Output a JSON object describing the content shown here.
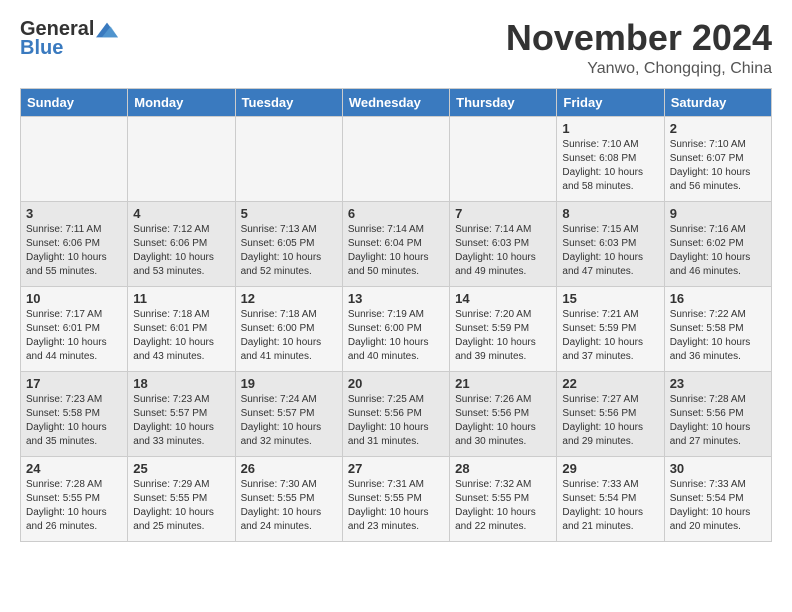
{
  "header": {
    "logo_general": "General",
    "logo_blue": "Blue",
    "month_title": "November 2024",
    "location": "Yanwo, Chongqing, China"
  },
  "days_of_week": [
    "Sunday",
    "Monday",
    "Tuesday",
    "Wednesday",
    "Thursday",
    "Friday",
    "Saturday"
  ],
  "weeks": [
    [
      {
        "day": "",
        "info": ""
      },
      {
        "day": "",
        "info": ""
      },
      {
        "day": "",
        "info": ""
      },
      {
        "day": "",
        "info": ""
      },
      {
        "day": "",
        "info": ""
      },
      {
        "day": "1",
        "info": "Sunrise: 7:10 AM\nSunset: 6:08 PM\nDaylight: 10 hours\nand 58 minutes."
      },
      {
        "day": "2",
        "info": "Sunrise: 7:10 AM\nSunset: 6:07 PM\nDaylight: 10 hours\nand 56 minutes."
      }
    ],
    [
      {
        "day": "3",
        "info": "Sunrise: 7:11 AM\nSunset: 6:06 PM\nDaylight: 10 hours\nand 55 minutes."
      },
      {
        "day": "4",
        "info": "Sunrise: 7:12 AM\nSunset: 6:06 PM\nDaylight: 10 hours\nand 53 minutes."
      },
      {
        "day": "5",
        "info": "Sunrise: 7:13 AM\nSunset: 6:05 PM\nDaylight: 10 hours\nand 52 minutes."
      },
      {
        "day": "6",
        "info": "Sunrise: 7:14 AM\nSunset: 6:04 PM\nDaylight: 10 hours\nand 50 minutes."
      },
      {
        "day": "7",
        "info": "Sunrise: 7:14 AM\nSunset: 6:03 PM\nDaylight: 10 hours\nand 49 minutes."
      },
      {
        "day": "8",
        "info": "Sunrise: 7:15 AM\nSunset: 6:03 PM\nDaylight: 10 hours\nand 47 minutes."
      },
      {
        "day": "9",
        "info": "Sunrise: 7:16 AM\nSunset: 6:02 PM\nDaylight: 10 hours\nand 46 minutes."
      }
    ],
    [
      {
        "day": "10",
        "info": "Sunrise: 7:17 AM\nSunset: 6:01 PM\nDaylight: 10 hours\nand 44 minutes."
      },
      {
        "day": "11",
        "info": "Sunrise: 7:18 AM\nSunset: 6:01 PM\nDaylight: 10 hours\nand 43 minutes."
      },
      {
        "day": "12",
        "info": "Sunrise: 7:18 AM\nSunset: 6:00 PM\nDaylight: 10 hours\nand 41 minutes."
      },
      {
        "day": "13",
        "info": "Sunrise: 7:19 AM\nSunset: 6:00 PM\nDaylight: 10 hours\nand 40 minutes."
      },
      {
        "day": "14",
        "info": "Sunrise: 7:20 AM\nSunset: 5:59 PM\nDaylight: 10 hours\nand 39 minutes."
      },
      {
        "day": "15",
        "info": "Sunrise: 7:21 AM\nSunset: 5:59 PM\nDaylight: 10 hours\nand 37 minutes."
      },
      {
        "day": "16",
        "info": "Sunrise: 7:22 AM\nSunset: 5:58 PM\nDaylight: 10 hours\nand 36 minutes."
      }
    ],
    [
      {
        "day": "17",
        "info": "Sunrise: 7:23 AM\nSunset: 5:58 PM\nDaylight: 10 hours\nand 35 minutes."
      },
      {
        "day": "18",
        "info": "Sunrise: 7:23 AM\nSunset: 5:57 PM\nDaylight: 10 hours\nand 33 minutes."
      },
      {
        "day": "19",
        "info": "Sunrise: 7:24 AM\nSunset: 5:57 PM\nDaylight: 10 hours\nand 32 minutes."
      },
      {
        "day": "20",
        "info": "Sunrise: 7:25 AM\nSunset: 5:56 PM\nDaylight: 10 hours\nand 31 minutes."
      },
      {
        "day": "21",
        "info": "Sunrise: 7:26 AM\nSunset: 5:56 PM\nDaylight: 10 hours\nand 30 minutes."
      },
      {
        "day": "22",
        "info": "Sunrise: 7:27 AM\nSunset: 5:56 PM\nDaylight: 10 hours\nand 29 minutes."
      },
      {
        "day": "23",
        "info": "Sunrise: 7:28 AM\nSunset: 5:56 PM\nDaylight: 10 hours\nand 27 minutes."
      }
    ],
    [
      {
        "day": "24",
        "info": "Sunrise: 7:28 AM\nSunset: 5:55 PM\nDaylight: 10 hours\nand 26 minutes."
      },
      {
        "day": "25",
        "info": "Sunrise: 7:29 AM\nSunset: 5:55 PM\nDaylight: 10 hours\nand 25 minutes."
      },
      {
        "day": "26",
        "info": "Sunrise: 7:30 AM\nSunset: 5:55 PM\nDaylight: 10 hours\nand 24 minutes."
      },
      {
        "day": "27",
        "info": "Sunrise: 7:31 AM\nSunset: 5:55 PM\nDaylight: 10 hours\nand 23 minutes."
      },
      {
        "day": "28",
        "info": "Sunrise: 7:32 AM\nSunset: 5:55 PM\nDaylight: 10 hours\nand 22 minutes."
      },
      {
        "day": "29",
        "info": "Sunrise: 7:33 AM\nSunset: 5:54 PM\nDaylight: 10 hours\nand 21 minutes."
      },
      {
        "day": "30",
        "info": "Sunrise: 7:33 AM\nSunset: 5:54 PM\nDaylight: 10 hours\nand 20 minutes."
      }
    ]
  ]
}
